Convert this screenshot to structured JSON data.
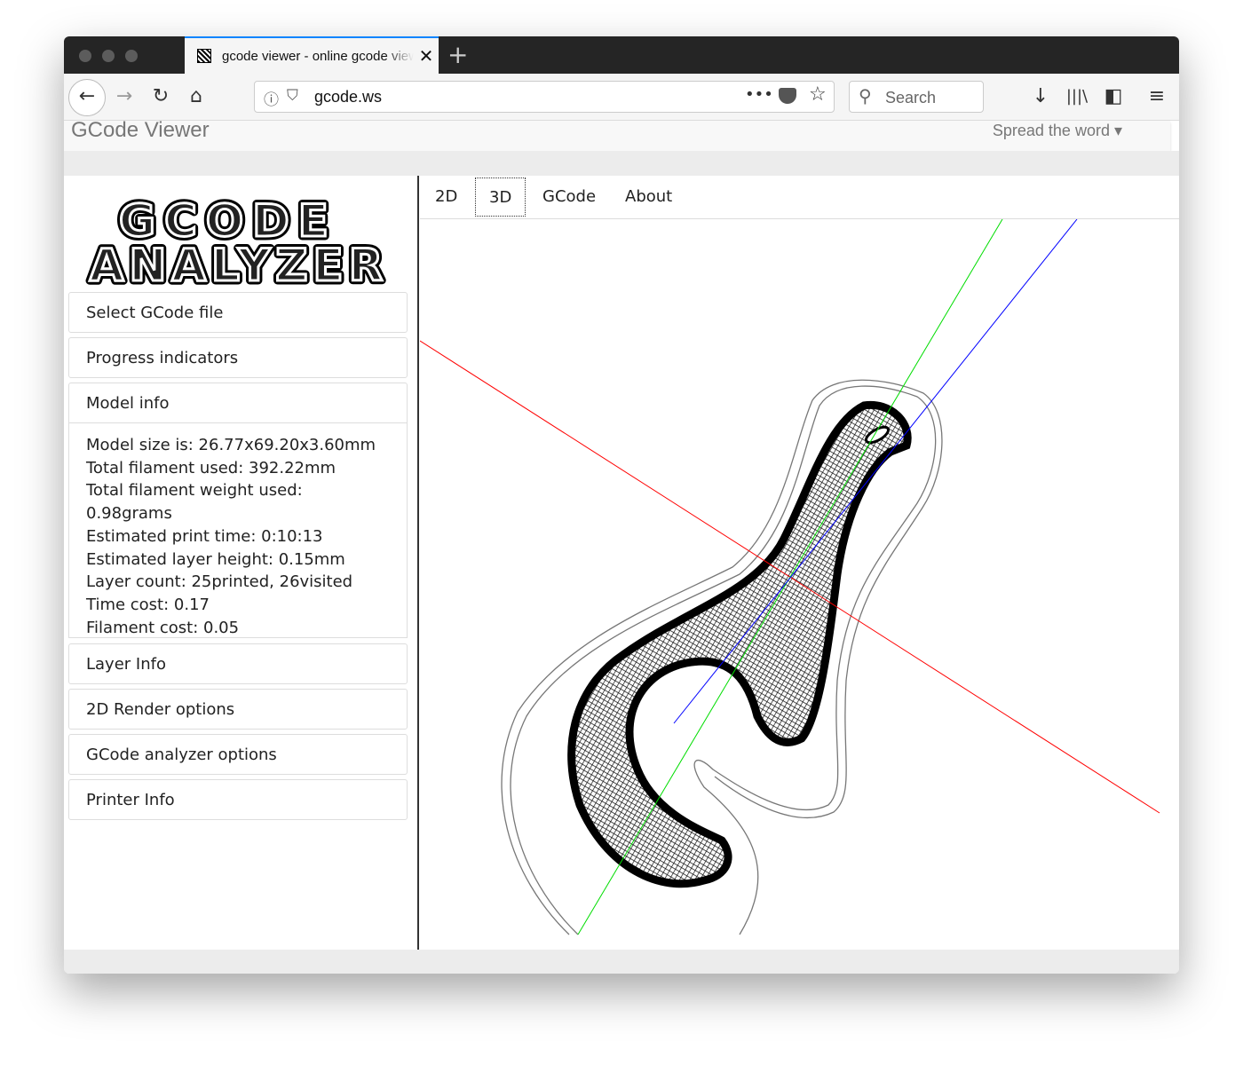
{
  "browser": {
    "tab_title": "gcode viewer - online gcode viewer",
    "new_tab": "+",
    "close": "✕",
    "url": "gcode.ws",
    "search_placeholder": "Search",
    "icons": [
      "back-icon",
      "forward-icon",
      "reload-icon",
      "home-icon",
      "info-icon",
      "shield-icon",
      "more-icon",
      "pocket-icon",
      "star-icon",
      "search-icon",
      "download-icon",
      "library-icon",
      "sidebar-icon",
      "menu-icon"
    ]
  },
  "navbar": {
    "brand": "GCode Viewer",
    "spread": "Spread the word ▾"
  },
  "logo": {
    "line1": "GCODE",
    "line2": "ANALYZER"
  },
  "sidebar": {
    "items": [
      {
        "label": "Select GCode file"
      },
      {
        "label": "Progress indicators"
      },
      {
        "label": "Model info"
      },
      {
        "label": "Layer Info"
      },
      {
        "label": "2D Render options"
      },
      {
        "label": "GCode analyzer options"
      },
      {
        "label": "Printer Info"
      }
    ],
    "model_info": [
      "Model size is: 26.77x69.20x3.60mm",
      "Total filament used: 392.22mm",
      "Total filament weight used: 0.98grams",
      "Estimated print time: 0:10:13",
      "Estimated layer height: 0.15mm",
      "Layer count: 25printed, 26visited",
      "Time cost: 0.17",
      "Filament cost: 0.05"
    ]
  },
  "viewer": {
    "tabs": [
      {
        "label": "2D"
      },
      {
        "label": "3D",
        "active": true
      },
      {
        "label": "GCode"
      },
      {
        "label": "About"
      }
    ],
    "axis_colors": {
      "x": "#ff0000",
      "y": "#00dd00",
      "z": "#0000ff"
    }
  }
}
